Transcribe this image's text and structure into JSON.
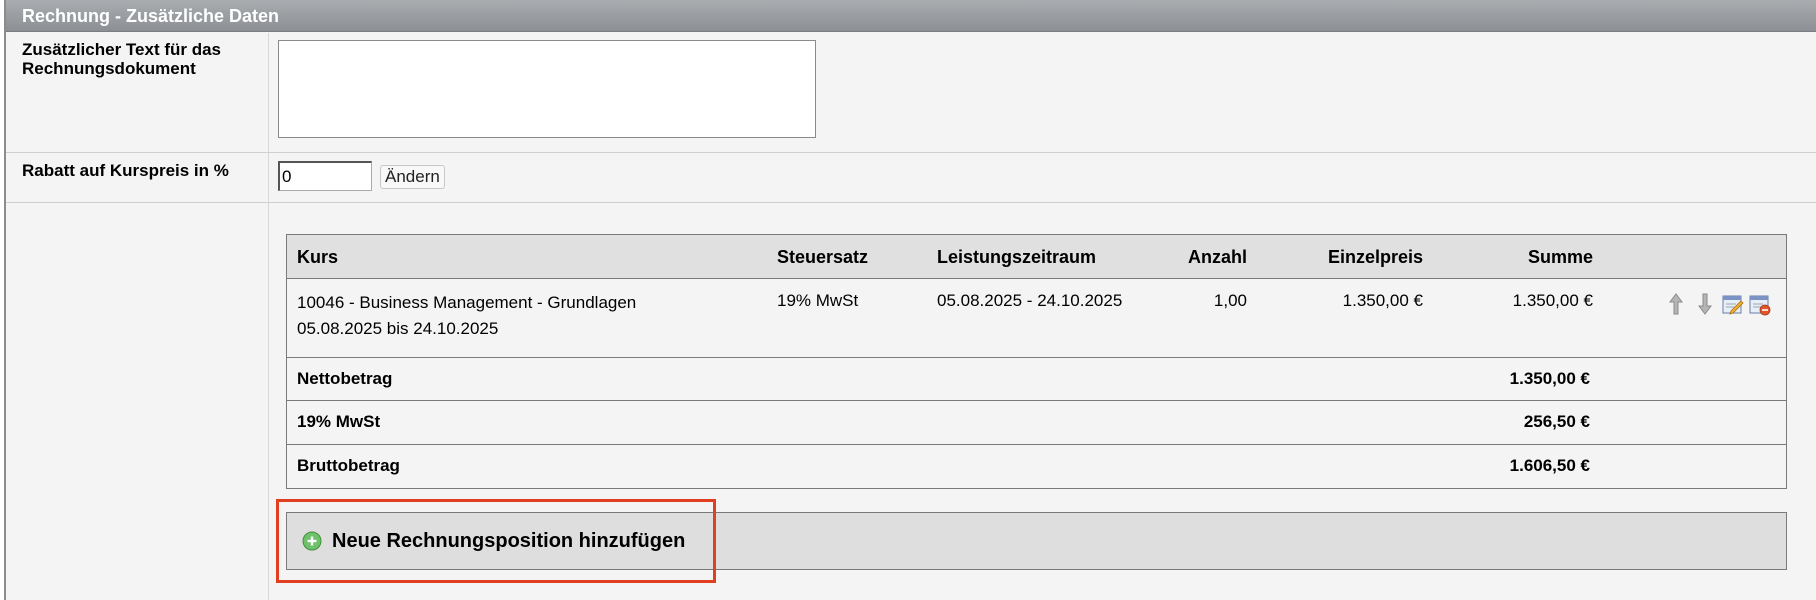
{
  "section": {
    "title": "Rechnung - Zusätzliche Daten"
  },
  "form": {
    "extra_text_label": "Zusätzlicher Text für das Rechnungsdokument",
    "extra_text_value": "",
    "discount_label": "Rabatt auf Kurspreis in %",
    "discount_value": "0",
    "change_button": "Ändern"
  },
  "table": {
    "headers": {
      "course": "Kurs",
      "tax_rate": "Steuersatz",
      "period": "Leistungszeitraum",
      "quantity": "Anzahl",
      "unit_price": "Einzelpreis",
      "sum": "Summe"
    },
    "rows": [
      {
        "course_line1": "10046 - Business Management - Grundlagen",
        "course_line2": "05.08.2025 bis 24.10.2025",
        "tax_rate": "19% MwSt",
        "period": "05.08.2025 - 24.10.2025",
        "quantity": "1,00",
        "unit_price": "1.350,00 €",
        "sum": "1.350,00 €",
        "actions": [
          "arrow-up-icon",
          "arrow-down-icon",
          "edit-icon",
          "delete-icon"
        ]
      }
    ],
    "totals": {
      "net_label": "Nettobetrag",
      "net_value": "1.350,00 €",
      "tax_label": "19% MwSt",
      "tax_value": "256,50 €",
      "gross_label": "Bruttobetrag",
      "gross_value": "1.606,50 €"
    }
  },
  "add_position": {
    "label": "Neue Rechnungsposition hinzufügen",
    "icon": "plus-circle-icon"
  },
  "colors": {
    "highlight": "#e0401f",
    "header_bg": "#8c9094",
    "add_icon": "#5cb85c"
  }
}
